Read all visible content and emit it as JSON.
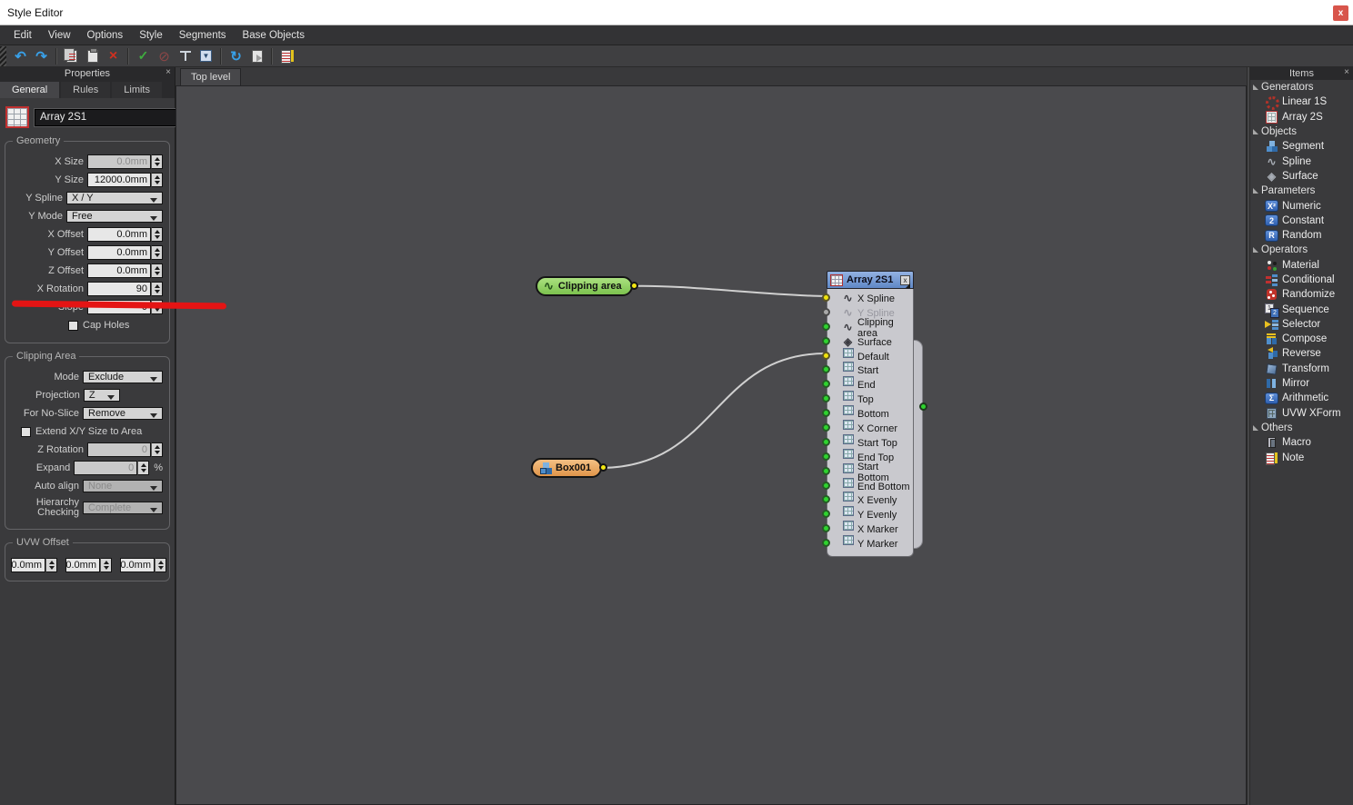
{
  "window": {
    "title": "Style Editor",
    "close_glyph": "x"
  },
  "menu": {
    "items": [
      "Edit",
      "View",
      "Options",
      "Style",
      "Segments",
      "Base Objects"
    ]
  },
  "toolbar": {
    "undo_glyph": "↶",
    "redo_glyph": "↷",
    "delete_glyph": "×",
    "apply_glyph": "✓",
    "disable_glyph": "⊘",
    "refresh_glyph": "↻",
    "collapse_glyph": "▼"
  },
  "properties": {
    "title": "Properties",
    "close_glyph": "×",
    "tabs": [
      "General",
      "Rules",
      "Limits"
    ],
    "name_value": "Array 2S1",
    "help_glyph": "?",
    "geometry": {
      "title": "Geometry",
      "rows": [
        {
          "label": "X Size",
          "value": "0.0mm",
          "disabled": true
        },
        {
          "label": "Y Size",
          "value": "12000.0mm"
        },
        {
          "label": "Y Spline",
          "value": "X / Y"
        },
        {
          "label": "Y Mode",
          "value": "Free"
        },
        {
          "label": "X Offset",
          "value": "0.0mm"
        },
        {
          "label": "Y Offset",
          "value": "0.0mm"
        },
        {
          "label": "Z Offset",
          "value": "0.0mm"
        },
        {
          "label": "X Rotation",
          "value": "90"
        },
        {
          "label": "Slope",
          "value": "0"
        },
        {
          "label": "Cap Holes",
          "checked": false
        }
      ]
    },
    "clipping": {
      "title": "Clipping Area",
      "rows": [
        {
          "label": "Mode",
          "value": "Exclude"
        },
        {
          "label": "Projection",
          "value": "Z"
        },
        {
          "label": "For No-Slice",
          "value": "Remove"
        },
        {
          "label": "Extend X/Y Size to Area",
          "checked": false
        },
        {
          "label": "Z Rotation",
          "value": "0",
          "disabled": true
        },
        {
          "label": "Expand",
          "value": "0",
          "suffix": "%",
          "disabled": true
        },
        {
          "label": "Auto align",
          "value": "None",
          "disabled": true
        },
        {
          "label": "Hierarchy Checking",
          "value": "Complete",
          "disabled": true
        }
      ]
    },
    "uvw": {
      "title": "UVW Offset",
      "values": [
        "0.0mm",
        "0.0mm",
        "0.0mm"
      ]
    }
  },
  "canvas": {
    "tab": "Top level"
  },
  "graph": {
    "clipping_node": {
      "label": "Clipping area"
    },
    "box_node": {
      "label": "Box001"
    },
    "array_node": {
      "title": "Array 2S1",
      "close_glyph": "x",
      "ports": [
        {
          "label": "X Spline",
          "dot": "yellow"
        },
        {
          "label": "Y Spline",
          "dot": "gray"
        },
        {
          "label": "Clipping area",
          "dot": "green"
        },
        {
          "label": "Surface",
          "dot": "green"
        },
        {
          "label": "Default",
          "dot": "yellow"
        },
        {
          "label": "Start",
          "dot": "green"
        },
        {
          "label": "End",
          "dot": "green"
        },
        {
          "label": "Top",
          "dot": "green"
        },
        {
          "label": "Bottom",
          "dot": "green"
        },
        {
          "label": "X Corner",
          "dot": "green"
        },
        {
          "label": "Start Top",
          "dot": "green"
        },
        {
          "label": "End Top",
          "dot": "green"
        },
        {
          "label": "Start Bottom",
          "dot": "green"
        },
        {
          "label": "End Bottom",
          "dot": "green"
        },
        {
          "label": "X Evenly",
          "dot": "green"
        },
        {
          "label": "Y Evenly",
          "dot": "green"
        },
        {
          "label": "X Marker",
          "dot": "green"
        },
        {
          "label": "Y Marker",
          "dot": "green"
        }
      ],
      "output_dot": "green"
    },
    "connections": [
      {
        "from": "Clipping area",
        "to": "X Spline"
      },
      {
        "from": "Box001",
        "to": "Default"
      }
    ]
  },
  "items": {
    "title": "Items",
    "close_glyph": "×",
    "sections": [
      {
        "label": "Generators",
        "entries": [
          {
            "label": "Linear 1S"
          },
          {
            "label": "Array 2S"
          }
        ]
      },
      {
        "label": "Objects",
        "entries": [
          {
            "label": "Segment"
          },
          {
            "label": "Spline"
          },
          {
            "label": "Surface"
          }
        ]
      },
      {
        "label": "Parameters",
        "entries": [
          {
            "label": "Numeric"
          },
          {
            "label": "Constant"
          },
          {
            "label": "Random"
          }
        ]
      },
      {
        "label": "Operators",
        "entries": [
          {
            "label": "Material"
          },
          {
            "label": "Conditional"
          },
          {
            "label": "Randomize"
          },
          {
            "label": "Sequence"
          },
          {
            "label": "Selector"
          },
          {
            "label": "Compose"
          },
          {
            "label": "Reverse"
          },
          {
            "label": "Transform"
          },
          {
            "label": "Mirror"
          },
          {
            "label": "Arithmetic"
          },
          {
            "label": "UVW XForm"
          }
        ]
      },
      {
        "label": "Others",
        "entries": [
          {
            "label": "Macro"
          },
          {
            "label": "Note"
          }
        ]
      }
    ]
  },
  "colors": {
    "node_header_blue": "#6f97cf",
    "port_green": "#2ed32e",
    "port_yellow": "#f0e30c",
    "port_gray": "#a8a8a8",
    "wire": "#d0d0d0",
    "annotation_red": "#e41414",
    "pill_green": "#8ccf63",
    "pill_orange": "#eda963",
    "close_button_red": "#d8554b"
  }
}
